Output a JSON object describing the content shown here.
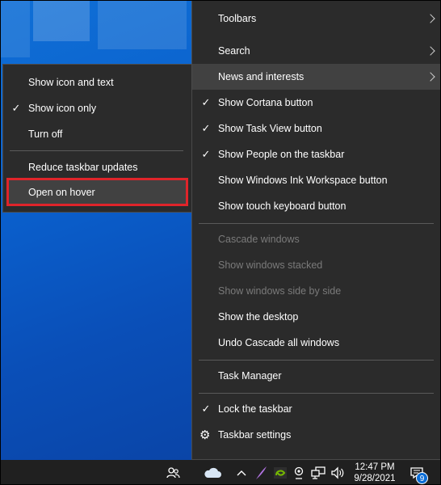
{
  "main_menu": {
    "items": [
      {
        "label": "Toolbars"
      },
      {
        "label": "Search"
      },
      {
        "label": "News and interests"
      },
      {
        "label": "Show Cortana button"
      },
      {
        "label": "Show Task View button"
      },
      {
        "label": "Show People on the taskbar"
      },
      {
        "label": "Show Windows Ink Workspace button"
      },
      {
        "label": "Show touch keyboard button"
      },
      {
        "label": "Cascade windows"
      },
      {
        "label": "Show windows stacked"
      },
      {
        "label": "Show windows side by side"
      },
      {
        "label": "Show the desktop"
      },
      {
        "label": "Undo Cascade all windows"
      },
      {
        "label": "Task Manager"
      },
      {
        "label": "Lock the taskbar"
      },
      {
        "label": "Taskbar settings"
      }
    ],
    "checked": [
      "Show Cortana button",
      "Show Task View button",
      "Show People on the taskbar",
      "Lock the taskbar"
    ],
    "disabled": [
      "Cascade windows",
      "Show windows stacked",
      "Show windows side by side"
    ],
    "submenu_arrows": [
      "Toolbars",
      "Search",
      "News and interests"
    ],
    "hovered": "News and interests"
  },
  "sub_menu": {
    "items": [
      {
        "label": "Show icon and text"
      },
      {
        "label": "Show icon only"
      },
      {
        "label": "Turn off"
      },
      {
        "label": "Reduce taskbar updates"
      },
      {
        "label": "Open on hover"
      }
    ],
    "checked": [
      "Show icon only"
    ],
    "highlighted": "Open on hover"
  },
  "taskbar": {
    "time": "12:47 PM",
    "date": "9/28/2021",
    "notification_count": "9",
    "icons": [
      "people-icon",
      "weather-cloud-icon",
      "show-hidden-icons-chevron",
      "feather-icon",
      "nvidia-icon",
      "webcam-icon",
      "network-icon",
      "volume-icon",
      "notification-center-icon"
    ]
  },
  "colors": {
    "menu_bg": "#2b2b2b",
    "highlight_border": "#e0242a",
    "taskbar_bg": "#202020",
    "desktop_blue": "#0a5fcc"
  }
}
